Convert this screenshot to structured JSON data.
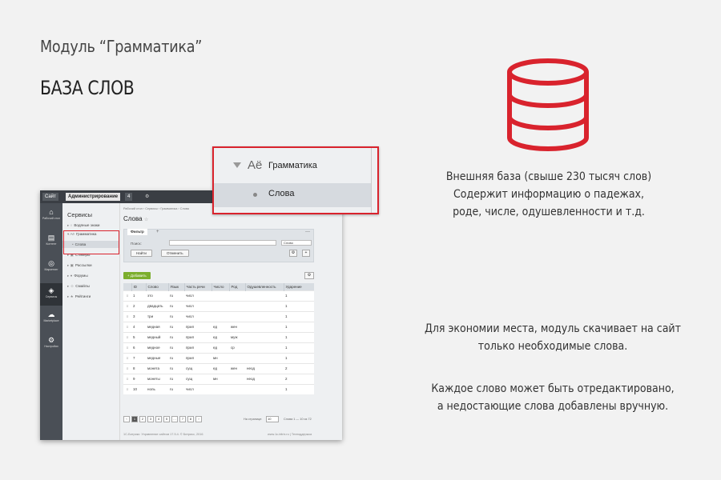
{
  "slide": {
    "subtitle": "Модуль “Грамматика”",
    "title": "БАЗА СЛОВ",
    "note1": [
      "Внешняя база (свыше 230 тысяч слов)",
      "Содержит информацию о падежах,",
      "роде, числе, одушевленности и т.д."
    ],
    "note2": [
      "Для экономии места, модуль скачивает на сайт",
      "только необходимые слова."
    ],
    "note3": [
      "Каждое слово может быть отредактировано,",
      "а недостающие слова добавлены вручную."
    ],
    "accent_color": "#d9232d",
    "icon": "database-icon"
  },
  "topbar": {
    "site": "Сайт",
    "admin": "Администрирование",
    "badge": "4",
    "gear": "⚙"
  },
  "leftnav": [
    {
      "label": "Рабочий стол",
      "icon": "home-icon",
      "glyph": "⌂"
    },
    {
      "label": "Контент",
      "icon": "document-icon",
      "glyph": "▤"
    },
    {
      "label": "Маркетинг",
      "icon": "target-icon",
      "glyph": "◎"
    },
    {
      "label": "Сервисы",
      "icon": "layers-icon",
      "glyph": "◈",
      "active": true
    },
    {
      "label": "Marketplace",
      "icon": "cloud-icon",
      "glyph": "☁"
    },
    {
      "label": "Настройки",
      "icon": "gear-icon",
      "glyph": "⚙"
    }
  ],
  "sidepanel": {
    "title": "Сервисы",
    "items": [
      "Водяные знаки",
      "Грамматика",
      "Слова",
      "Стикеры",
      "Рассылки",
      "Форумы",
      "Смайлы",
      "Рейтинги"
    ]
  },
  "content": {
    "breadcrumbs": "Рабочий стол  ›  Сервисы  ›  Грамматика  ›  Слова",
    "page_title": "Слова",
    "filter": {
      "tab": "Фильтр",
      "search_label": "Поиск:",
      "select_value": "Слово",
      "find": "Найти",
      "cancel": "Отменить"
    },
    "add": "+ Добавить",
    "table": {
      "headers": [
        "",
        "ID",
        "Слово",
        "Язык",
        "Часть речи",
        "Число",
        "Род",
        "Одушевленность",
        "Ударение"
      ],
      "rows": [
        [
          "1",
          "это",
          "ru",
          "числ",
          "",
          "",
          "",
          "1"
        ],
        [
          "2",
          "двадцать",
          "ru",
          "числ",
          "",
          "",
          "",
          "1"
        ],
        [
          "3",
          "три",
          "ru",
          "числ",
          "",
          "",
          "",
          "1"
        ],
        [
          "4",
          "медная",
          "ru",
          "прил",
          "ед",
          "жен",
          "",
          "1"
        ],
        [
          "5",
          "медный",
          "ru",
          "прил",
          "ед",
          "муж",
          "",
          "1"
        ],
        [
          "6",
          "медное",
          "ru",
          "прил",
          "ед",
          "ср",
          "",
          "1"
        ],
        [
          "7",
          "медные",
          "ru",
          "прил",
          "мн",
          "",
          "",
          "1"
        ],
        [
          "8",
          "монета",
          "ru",
          "сущ",
          "ед",
          "жен",
          "неод",
          "2"
        ],
        [
          "9",
          "монеты",
          "ru",
          "сущ",
          "мн",
          "",
          "неод",
          "2"
        ],
        [
          "10",
          "ноль",
          "ru",
          "числ",
          "",
          "",
          "",
          "1"
        ]
      ]
    },
    "pager": {
      "pages": [
        "‹",
        "1",
        "2",
        "3",
        "4",
        "5",
        "…",
        "7",
        "8",
        "›"
      ],
      "per_page_label": "На странице:",
      "per_page": "10",
      "count": "Слова 1 — 10 из 72"
    },
    "footer_left": "1С-Битрикс: Управление сайтом 17.5.4. © Битрикс, 2016",
    "footer_right": "www.1c-bitrix.ru  |  Техподдержка"
  },
  "zoom": {
    "icon": "Aё",
    "item1": "Грамматика",
    "item2": "Слова"
  }
}
